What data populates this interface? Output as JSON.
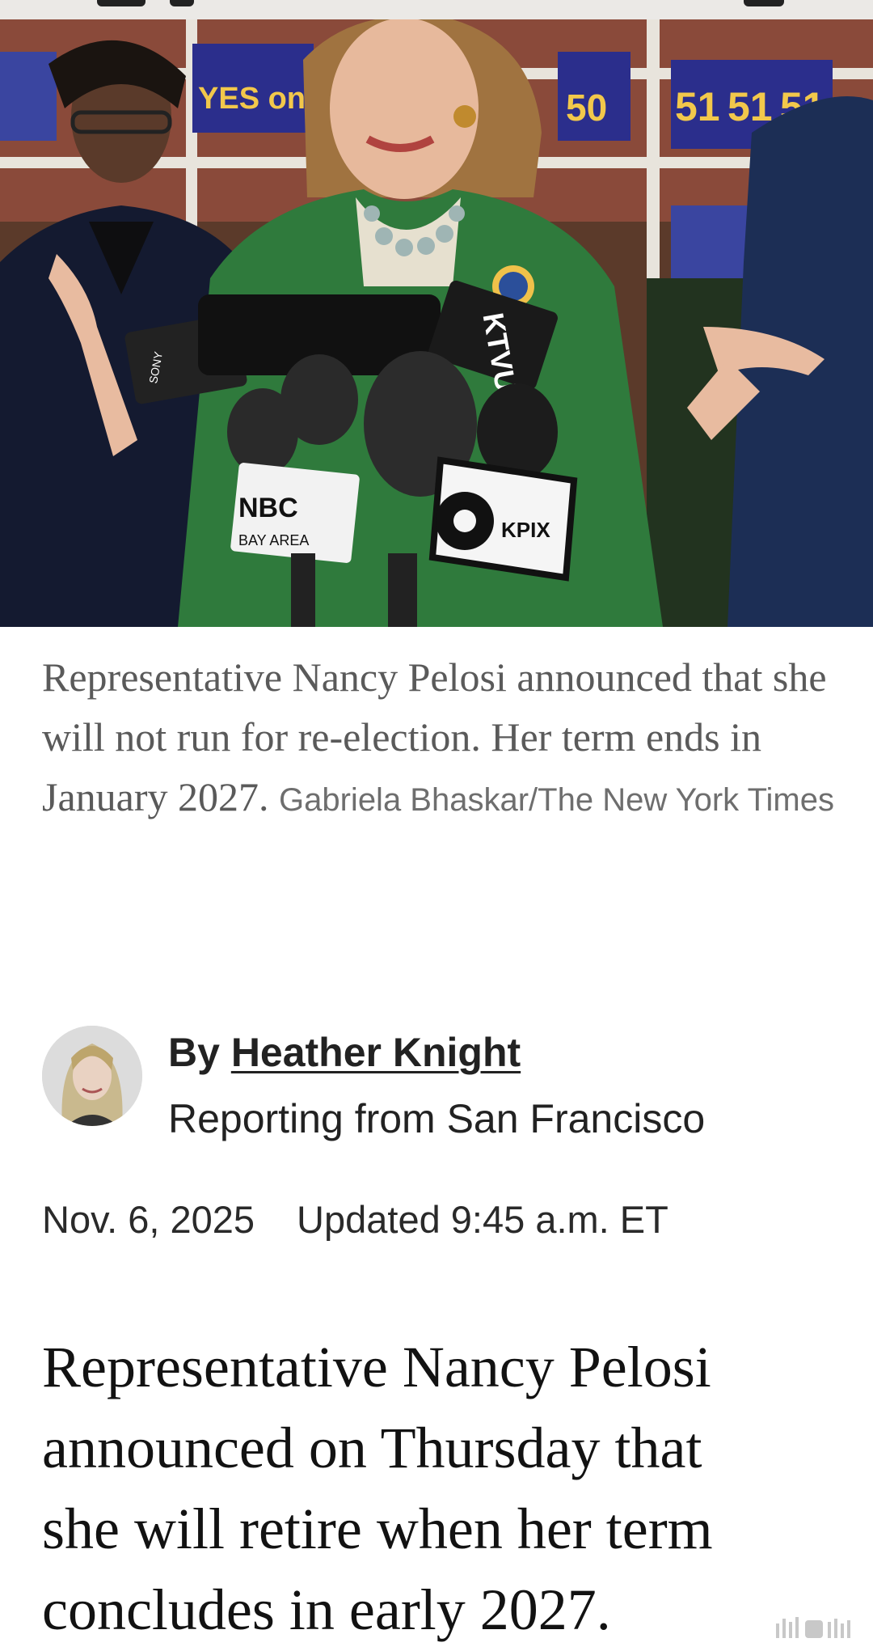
{
  "photo": {
    "signs": [
      "YES on",
      "50",
      "51",
      "51",
      "51"
    ],
    "mic_flags": [
      "NBC",
      "BAY AREA",
      "KTVU",
      "KPIX",
      "SONY"
    ]
  },
  "caption": {
    "text": "Representative Nancy Pelosi announced that she will not run for re-election. Her term ends in January 2027.",
    "credit": "Gabriela Bhaskar/The New York Times"
  },
  "byline": {
    "prefix": "By",
    "author": "Heather Knight",
    "location": "Reporting from San Francisco"
  },
  "dateline": {
    "date": "Nov. 6, 2025",
    "updated": "Updated 9:45 a.m. ET"
  },
  "lede": {
    "lines": [
      "Representative Nancy Pelosi",
      "announced on Thursday that",
      "she will retire when her term",
      "concludes in early 2027."
    ]
  }
}
